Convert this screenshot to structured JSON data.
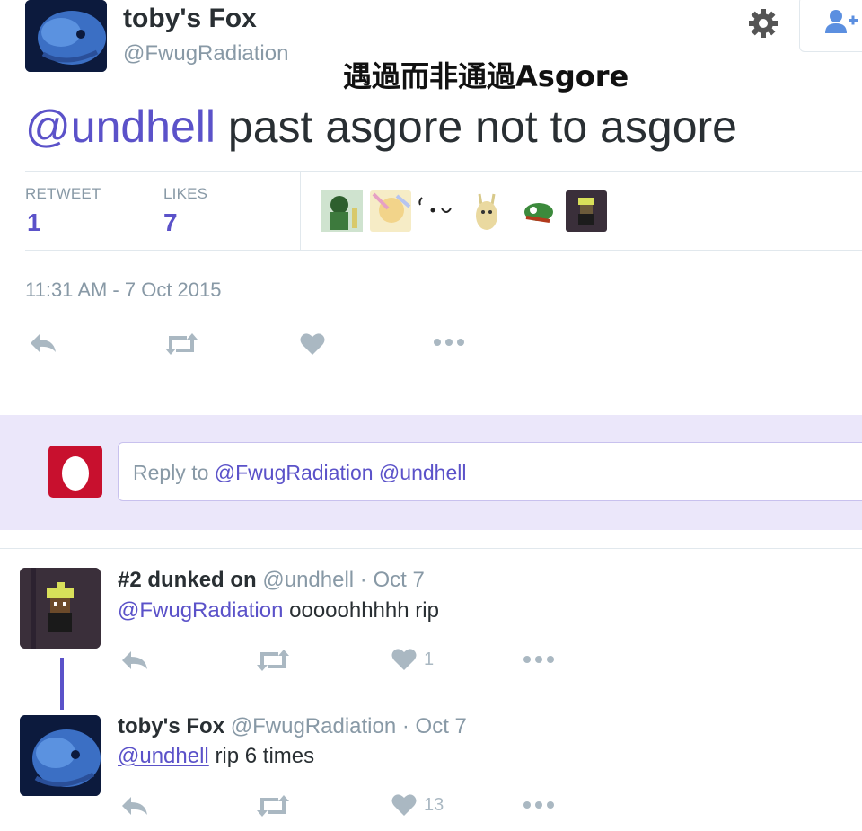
{
  "overlay_caption": "遇過而非通過Asgore",
  "main_tweet": {
    "author_name": "toby's Fox",
    "author_handle": "@FwugRadiation",
    "mention": "@undhell",
    "text": "past asgore not to asgore",
    "retweet_label": "RETWEET",
    "retweet_count": "1",
    "likes_label": "LIKES",
    "likes_count": "7",
    "timestamp": "11:31 AM - 7 Oct 2015"
  },
  "reply_composer": {
    "prefix": "Reply to",
    "mentions": "@FwugRadiation @undhell"
  },
  "replies": [
    {
      "author_name": "#2 dunked on",
      "author_handle": "@undhell",
      "date": "· Oct 7",
      "mention": "@FwugRadiation",
      "text": "ooooohhhhh rip",
      "like_count": "1"
    },
    {
      "author_name": "toby's Fox",
      "author_handle": "@FwugRadiation",
      "date": "· Oct 7",
      "mention": "@undhell",
      "text": "rip 6 times",
      "like_count": "13"
    }
  ],
  "icons": {
    "settings": "gear-icon",
    "follow": "add-user-icon",
    "reply": "reply-icon",
    "retweet": "retweet-icon",
    "like": "heart-icon",
    "more": "more-icon"
  },
  "colors": {
    "accent": "#5b52c9",
    "muted": "#8899a6",
    "reply_band": "#ebe7fa",
    "egg_avatar": "#c8102e"
  }
}
